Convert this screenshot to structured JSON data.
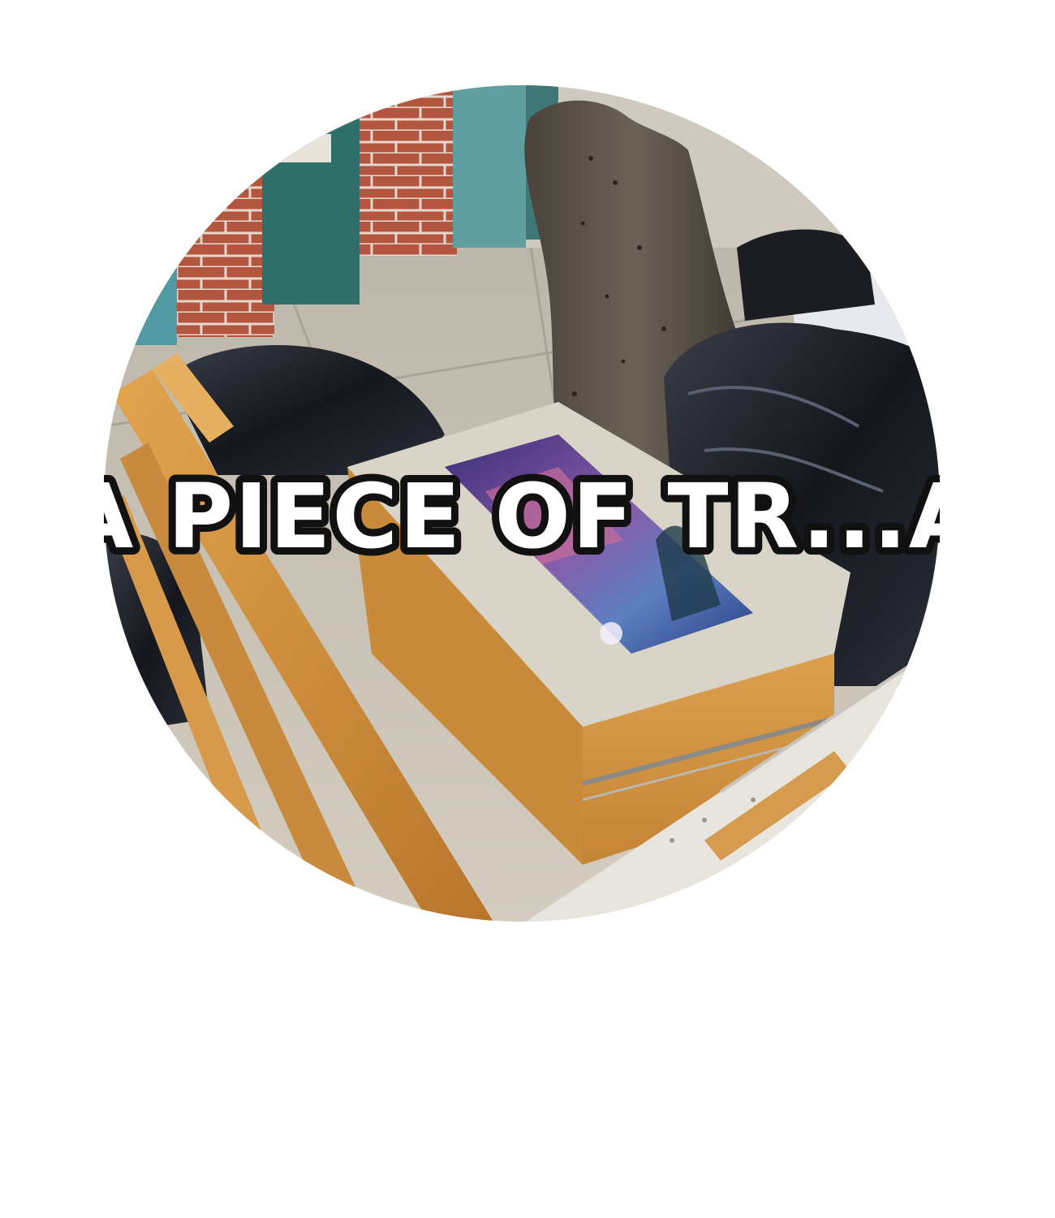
{
  "overlay_caption": {
    "text": "A PIECE OF TR...A",
    "fill_color": "#ffffff",
    "outline_color": "#111111"
  },
  "colors": {
    "background": "#ffffff",
    "sidewalk": "#c7c0b3",
    "brick": "#b4553f",
    "teal_wall": "#5f9fa0",
    "wood_drawer": "#d4953f",
    "trash_bag": "#1d1f26",
    "stone": "#5a5249"
  }
}
